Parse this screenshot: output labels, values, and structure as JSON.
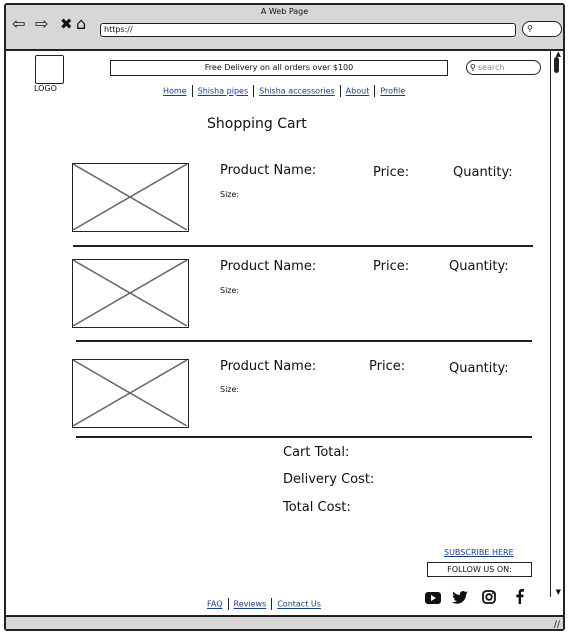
{
  "browser": {
    "window_title": "A Web Page",
    "url": "https://"
  },
  "header": {
    "logo_label": "LOGO",
    "promo_text": "Free Delivery on all orders over $100",
    "search_placeholder": "search"
  },
  "nav": {
    "items": [
      {
        "label": "Home"
      },
      {
        "label": "Shisha pipes"
      },
      {
        "label": "Shisha accessories"
      },
      {
        "label": "About"
      },
      {
        "label": "Profile"
      }
    ]
  },
  "cart": {
    "title": "Shopping Cart",
    "items": [
      {
        "name_label": "Product Name:",
        "price_label": "Price:",
        "quantity_label": "Quantity:",
        "size_label": "Size:"
      },
      {
        "name_label": "Product Name:",
        "price_label": "Price:",
        "quantity_label": "Quantity:",
        "size_label": "Size:"
      },
      {
        "name_label": "Product Name:",
        "price_label": "Price:",
        "quantity_label": "Quantity:",
        "size_label": "Size:"
      }
    ],
    "cart_total_label": "Cart Total:",
    "delivery_cost_label": "Delivery Cost:",
    "total_cost_label": "Total Cost:"
  },
  "footer": {
    "subscribe_label": "SUBSCRIBE HERE",
    "follow_label": "FOLLOW US ON:",
    "social_icons": [
      "youtube-icon",
      "twitter-icon",
      "instagram-icon",
      "facebook-icon"
    ],
    "links": [
      {
        "label": "FAQ"
      },
      {
        "label": "Reviews"
      },
      {
        "label": "Contact Us"
      }
    ]
  }
}
